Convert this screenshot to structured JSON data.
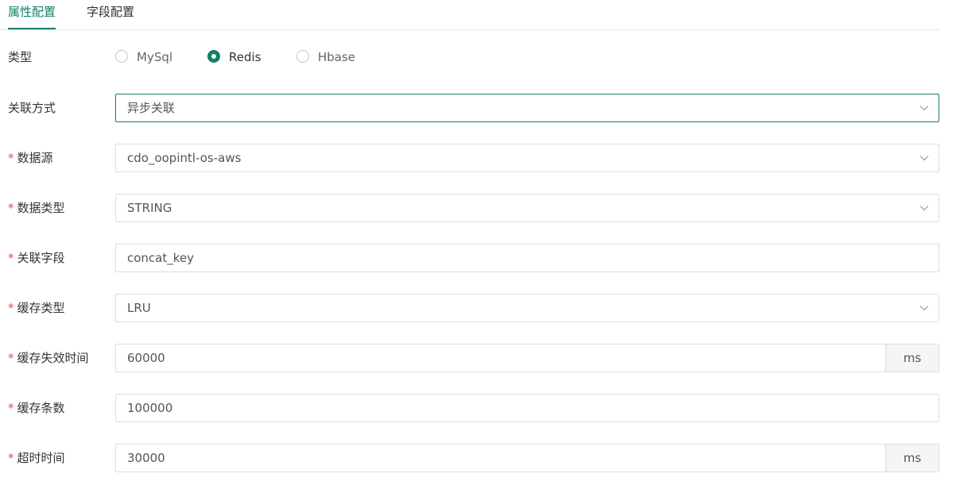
{
  "tabs": {
    "attr_config": "属性配置",
    "field_config": "字段配置"
  },
  "type_row": {
    "label": "类型",
    "options": [
      "MySql",
      "Redis",
      "Hbase"
    ],
    "selected": "Redis"
  },
  "join_mode": {
    "label": "关联方式",
    "value": "异步关联"
  },
  "data_source": {
    "required": "*",
    "label": "数据源",
    "value": "cdo_oopintl-os-aws"
  },
  "data_type": {
    "required": "*",
    "label": "数据类型",
    "value": "STRING"
  },
  "join_field": {
    "required": "*",
    "label": "关联字段",
    "value": "concat_key"
  },
  "cache_type": {
    "required": "*",
    "label": "缓存类型",
    "value": "LRU"
  },
  "cache_ttl": {
    "required": "*",
    "label": "缓存失效时间",
    "value": "60000",
    "unit": "ms"
  },
  "cache_size": {
    "required": "*",
    "label": "缓存条数",
    "value": "100000"
  },
  "timeout": {
    "required": "*",
    "label": "超时时间",
    "value": "30000",
    "unit": "ms"
  },
  "colors": {
    "accent": "#12806a",
    "required": "#e34d4d",
    "border": "#dcdcdc"
  },
  "icons": {
    "dropdown": "chevron-down-icon"
  }
}
